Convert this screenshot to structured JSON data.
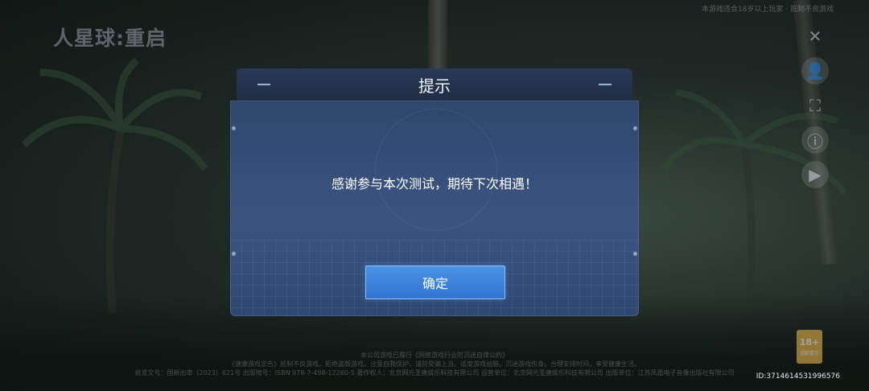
{
  "app": {
    "logo_text": "人星球:重启",
    "top_note": "本游戏适合18岁以上玩家 · 抵制不良游戏"
  },
  "dialog": {
    "title": "提示",
    "message": "感谢参与本次测试，期待下次相遇！",
    "confirm_label": "确定"
  },
  "side_icons": [
    {
      "name": "tools-icon",
      "glyph": "✕"
    },
    {
      "name": "account-icon",
      "glyph": "👤"
    },
    {
      "name": "scan-icon",
      "glyph": "⛶"
    },
    {
      "name": "info-icon",
      "glyph": "ⓘ"
    },
    {
      "name": "video-icon",
      "glyph": "▶"
    }
  ],
  "footer": {
    "line1": "本公司游戏已履行《网络游戏行业防沉迷自律公约》",
    "line2": "《健康游戏忠告》抵制不良游戏，拒绝盗版游戏。注意自我保护，谨防受骗上当。适度游戏益脑，沉迷游戏伤身。合理安排时间，享受健康生活。",
    "line3": "批准文号：国新出审〔2023〕621号 出版物号：ISBN 978-7-498-12260-5 著作权人：北京网元圣唐娱乐科技有限公司 运营单位：北京网元圣唐娱乐科技有限公司 出版单位：江苏凤凰电子音像出版社有限公司"
  },
  "age_badge": {
    "label": "18+",
    "sub": "适龄提示"
  },
  "device_id": "ID:3714614531996576",
  "colors": {
    "dialog_body": "#3a5583",
    "dialog_title": "#1f2d45",
    "confirm_button": "#2f74cf",
    "accent_border": "#8cc2ff"
  }
}
